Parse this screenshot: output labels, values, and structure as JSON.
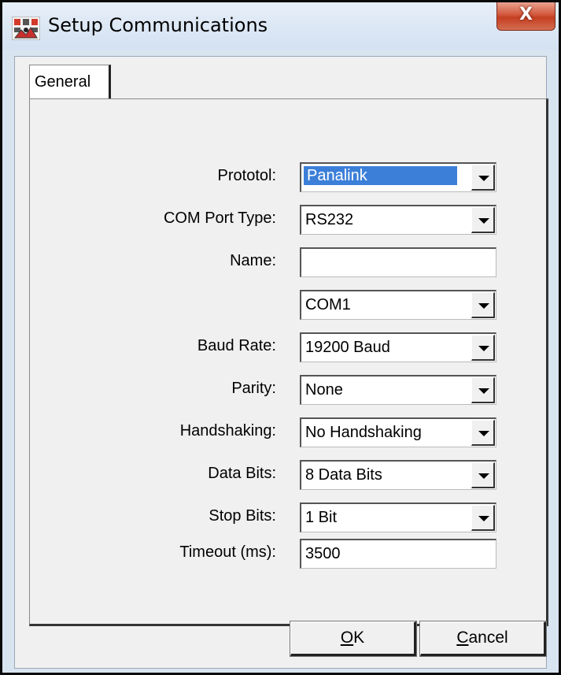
{
  "window": {
    "title": "Setup Communications",
    "close_label": "X"
  },
  "tabs": [
    {
      "label": "General",
      "selected": true
    }
  ],
  "form": {
    "protocol": {
      "label": "Prototol:",
      "value": "Panalink",
      "type": "select",
      "highlighted": true
    },
    "com_port_type": {
      "label": "COM Port Type:",
      "value": "RS232",
      "type": "select"
    },
    "name": {
      "label": "Name:",
      "value": "",
      "type": "text"
    },
    "com_port": {
      "label": "",
      "value": "COM1",
      "type": "select"
    },
    "baud_rate": {
      "label": "Baud Rate:",
      "value": "19200 Baud",
      "type": "select"
    },
    "parity": {
      "label": "Parity:",
      "value": "None",
      "type": "select"
    },
    "handshaking": {
      "label": "Handshaking:",
      "value": "No Handshaking",
      "type": "select"
    },
    "data_bits": {
      "label": "Data Bits:",
      "value": "8 Data Bits",
      "type": "select"
    },
    "stop_bits": {
      "label": "Stop Bits:",
      "value": "1 Bit",
      "type": "select"
    },
    "timeout": {
      "label": "Timeout (ms):",
      "value": "3500",
      "type": "text"
    }
  },
  "buttons": {
    "ok_mnemonic": "O",
    "ok_rest": "K",
    "cancel_mnemonic": "C",
    "cancel_rest": "ancel"
  },
  "colors": {
    "selection": "#3c7fd9",
    "close_button": "#c43f23",
    "titlebar": "#d9e4f1"
  },
  "icons": [
    "app-icon",
    "close-icon",
    "dropdown-arrow-icon"
  ]
}
